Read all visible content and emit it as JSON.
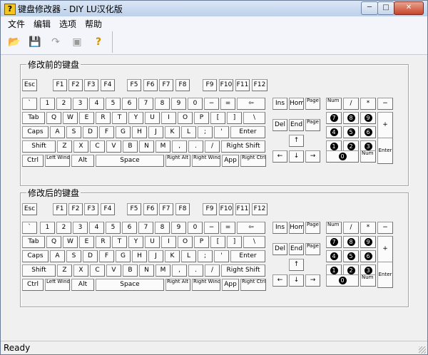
{
  "window": {
    "title": "键盘修改器 - DIY    LU汉化版",
    "min": "─",
    "max": "□",
    "close": "✕"
  },
  "menu": [
    "文件",
    "编辑",
    "选项",
    "帮助"
  ],
  "toolbar": [
    {
      "name": "open-icon",
      "glyph": "📂"
    },
    {
      "name": "save-icon",
      "glyph": "💾"
    },
    {
      "name": "convert-icon",
      "glyph": "↷"
    },
    {
      "name": "preview-icon",
      "glyph": "▣"
    },
    {
      "name": "help-icon",
      "glyph": "?"
    }
  ],
  "groups": [
    {
      "label": "修改前的键盘",
      "id": "before"
    },
    {
      "label": "修改后的键盘",
      "id": "after"
    }
  ],
  "keys": {
    "fn": [
      "Esc",
      "F1",
      "F2",
      "F3",
      "F4",
      "F5",
      "F6",
      "F7",
      "F8",
      "F9",
      "F10",
      "F11",
      "F12"
    ],
    "row1": [
      "`",
      "1",
      "2",
      "3",
      "4",
      "5",
      "6",
      "7",
      "8",
      "9",
      "0",
      "−",
      "=",
      "⇦"
    ],
    "row2": [
      "Tab",
      "Q",
      "W",
      "E",
      "R",
      "T",
      "Y",
      "U",
      "I",
      "O",
      "P",
      "[",
      "]",
      "\\"
    ],
    "row3": [
      "Caps",
      "A",
      "S",
      "D",
      "F",
      "G",
      "H",
      "J",
      "K",
      "L",
      ";",
      "'",
      "Enter"
    ],
    "row4": [
      "Shift",
      "Z",
      "X",
      "C",
      "V",
      "B",
      "N",
      "M",
      ",",
      ".",
      "/",
      "Right Shift"
    ],
    "row5": [
      "Ctrl",
      "Left Windows",
      "Alt",
      "Space",
      "Right Alt",
      "Right Windows",
      "App",
      "Right Ctrl"
    ],
    "nav1": [
      "Ins",
      "Home",
      "Page Up"
    ],
    "nav2": [
      "Del",
      "End",
      "Page Down"
    ],
    "arrows": [
      "↑",
      "←",
      "↓",
      "→"
    ],
    "numpad": {
      "top": [
        "Num Lock",
        "/",
        "*",
        "−"
      ],
      "r1": [
        "7",
        "8",
        "9"
      ],
      "r2": [
        "4",
        "5",
        "6"
      ],
      "r3": [
        "1",
        "2",
        "3"
      ],
      "plus": "+",
      "zero": "0",
      "del": "Num Del",
      "enter": "Enter"
    }
  },
  "status": "Ready"
}
